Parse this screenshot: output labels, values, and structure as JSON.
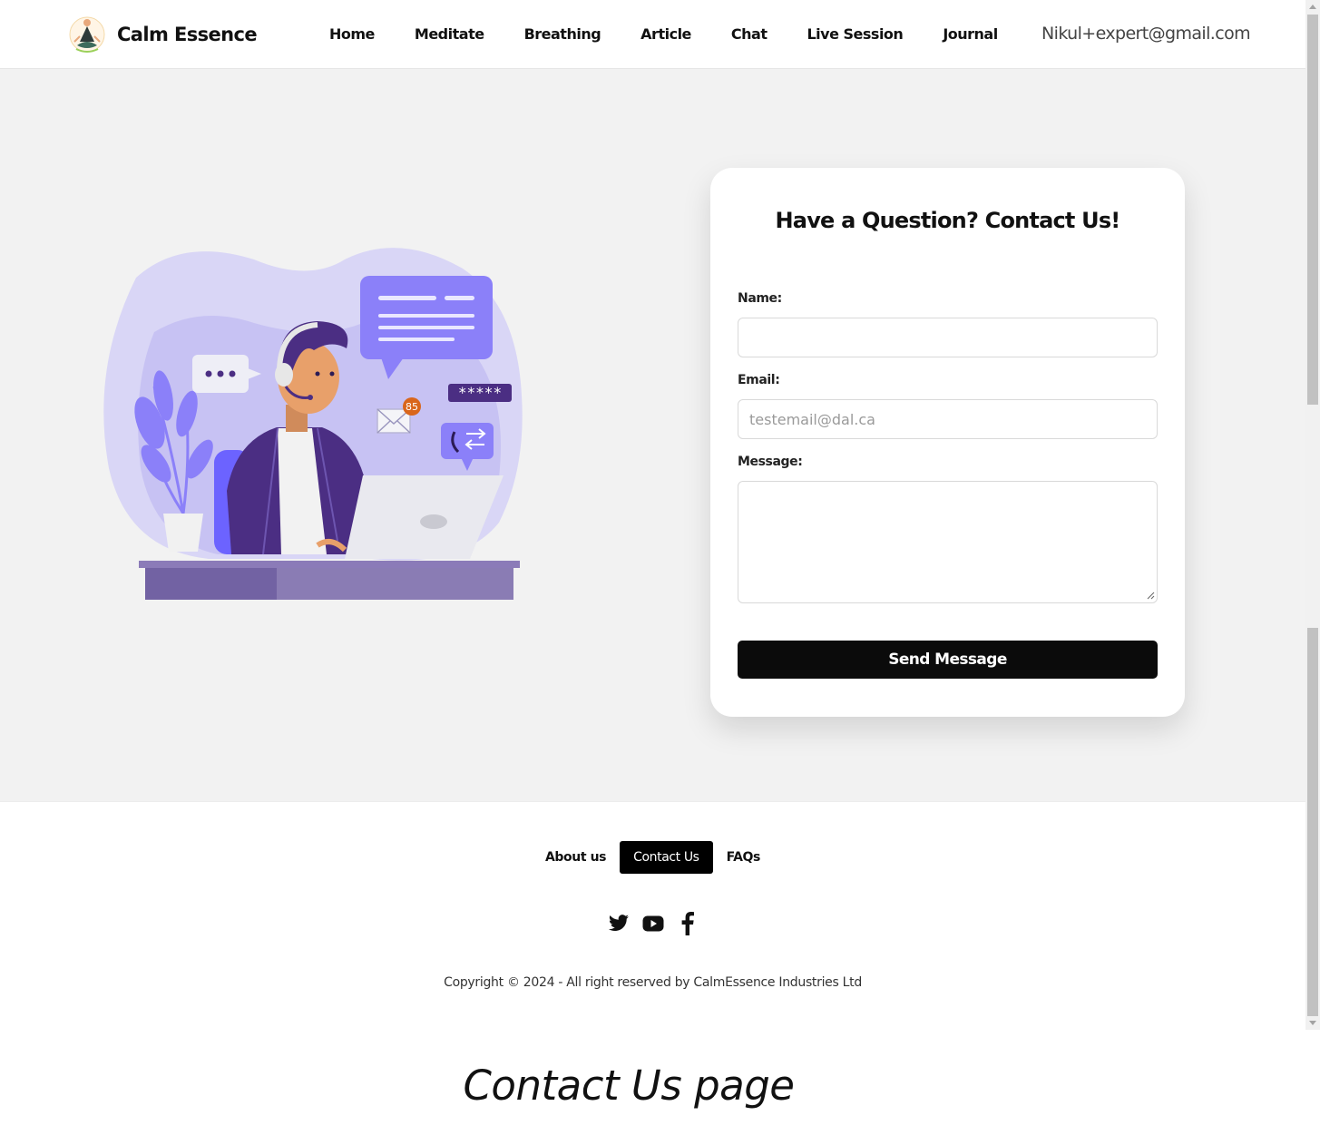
{
  "header": {
    "brand": "Calm Essence",
    "nav": [
      "Home",
      "Meditate",
      "Breathing",
      "Article",
      "Chat",
      "Live Session",
      "Journal"
    ],
    "user_email": "Nikul+expert@gmail.com"
  },
  "contact_form": {
    "title": "Have a Question? Contact Us!",
    "name_label": "Name:",
    "name_value": "",
    "email_label": "Email:",
    "email_placeholder": "testemail@dal.ca",
    "message_label": "Message:",
    "message_value": "",
    "submit_label": "Send Message"
  },
  "illustration": {
    "badge_count": "85",
    "password_mask": "*****"
  },
  "footer": {
    "links": [
      "About us",
      "Contact Us",
      "FAQs"
    ],
    "active_link": "Contact Us",
    "social_icons": [
      "twitter-icon",
      "youtube-icon",
      "facebook-icon"
    ],
    "copyright": "Copyright © 2024 - All right reserved by CalmEssence Industries Ltd"
  },
  "caption": "Contact Us page",
  "colors": {
    "accent_purple": "#8b80f9",
    "dark_purple": "#4b2e83",
    "page_bg": "#f2f2f2",
    "button_black": "#0b0b0b"
  }
}
